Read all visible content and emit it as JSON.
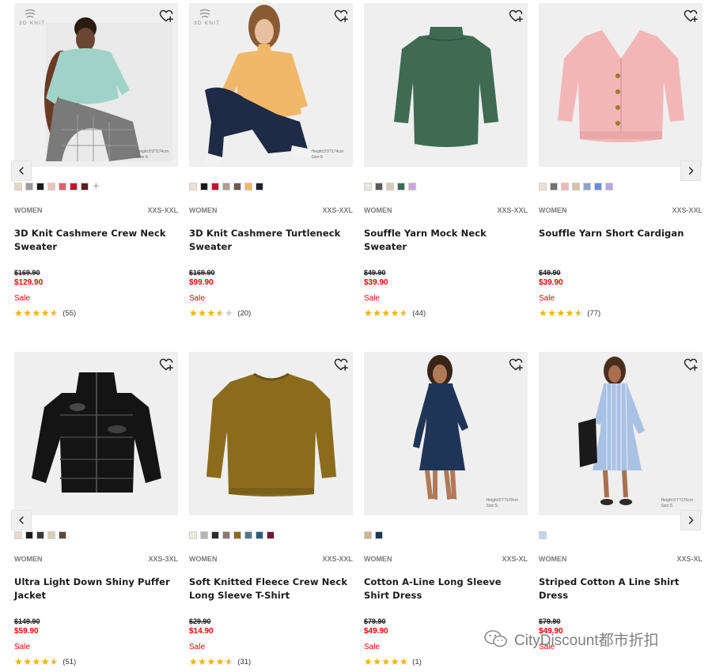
{
  "colors": {
    "sale_red": "#ff0000",
    "star": "#f4b400",
    "image_bg": "#efefef"
  },
  "products": [
    {
      "gender": "WOMEN",
      "sizes": "XXS-XXL",
      "name": "3D Knit Cashmere Crew Neck Sweater",
      "original_price": "$169.90",
      "sale_price": "$129.90",
      "flag": "Sale",
      "rating": 4.5,
      "reviews": "(55)",
      "badge": "3D KNIT",
      "model_info": [
        "Height:5'9\"/174cm",
        "Size:S"
      ],
      "image_desc": "model-mint-sweater",
      "garment_color": "#9fd3c7",
      "swatches": [
        "#e9d7c3",
        "#9a9a9a",
        "#1a1a1a",
        "#e6c3bd",
        "#e06070",
        "#c8102e",
        "#5a1e1e"
      ],
      "more_colors": "+"
    },
    {
      "gender": "WOMEN",
      "sizes": "XXS-XXL",
      "name": "3D Knit Cashmere Turtleneck Sweater",
      "original_price": "$169.90",
      "sale_price": "$99.90",
      "flag": "Sale",
      "rating": 3.5,
      "reviews": "(20)",
      "badge": "3D KNIT",
      "model_info": [
        "Height:5'9\"/174cm",
        "Size:S"
      ],
      "image_desc": "model-yellow-turtleneck",
      "garment_color": "#f1b86a",
      "swatches": [
        "#ece1d1",
        "#1a1a1a",
        "#c8102e",
        "#b39a8e",
        "#6e5a4e",
        "#f1b86a",
        "#1e2230"
      ]
    },
    {
      "gender": "WOMEN",
      "sizes": "XXS-XXL",
      "name": "Souffle Yarn Mock Neck Sweater",
      "original_price": "$49.90",
      "sale_price": "$39.90",
      "flag": "Sale",
      "rating": 4.5,
      "reviews": "(44)",
      "image_desc": "green-mock-neck-sweater",
      "garment_color": "#3e6b52",
      "swatches": [
        "#ece8df",
        "#5a5a5a",
        "#d8c9b3",
        "#3e6b52",
        "#c8a8dc"
      ]
    },
    {
      "gender": "WOMEN",
      "sizes": "XXS-XXL",
      "name": "Souffle Yarn Short Cardigan",
      "original_price": "$49.90",
      "sale_price": "$39.90",
      "flag": "Sale",
      "rating": 4.5,
      "reviews": "(77)",
      "image_desc": "pink-cardigan",
      "garment_color": "#f3b6b6",
      "swatches": [
        "#ece0d0",
        "#707070",
        "#f3b6b6",
        "#d9c2a3",
        "#8fa6c8",
        "#6a8fd8",
        "#b8a5e2"
      ]
    },
    {
      "gender": "WOMEN",
      "sizes": "XXS-3XL",
      "name": "Ultra Light Down Shiny Puffer Jacket",
      "original_price": "$149.90",
      "sale_price": "$59.90",
      "flag": "Sale",
      "rating": 4.5,
      "reviews": "(51)",
      "image_desc": "black-puffer-jacket",
      "garment_color": "#141414",
      "swatches": [
        "#e6dcd3",
        "#1a1a1a",
        "#3a3a3a",
        "#d8ccb8",
        "#5a4a40"
      ]
    },
    {
      "gender": "WOMEN",
      "sizes": "XXS-XXL",
      "name": "Soft Knitted Fleece Crew Neck Long Sleeve T-Shirt",
      "original_price": "$29.90",
      "sale_price": "$14.90",
      "flag": "Sale",
      "rating": 4.5,
      "reviews": "(31)",
      "image_desc": "olive-crew-neck-tshirt",
      "garment_color": "#8a6c1c",
      "swatches": [
        "#ece8df",
        "#b4b4b4",
        "#2a2a2a",
        "#8c7a6e",
        "#8a6c1c",
        "#4d7a8c",
        "#2e5b78",
        "#6a1a3a"
      ]
    },
    {
      "gender": "WOMEN",
      "sizes": "XXS-XL",
      "name": "Cotton A-Line Long Sleeve Shirt Dress",
      "original_price": "$79.90",
      "sale_price": "$49.90",
      "flag": "Sale",
      "rating": 5,
      "reviews": "(1)",
      "model_info": [
        "Height:5'7\"/170cm",
        "Size:S"
      ],
      "image_desc": "model-navy-shirt-dress",
      "garment_color": "#1f3557",
      "swatches": [
        "#cdb594",
        "#1f3557"
      ]
    },
    {
      "gender": "WOMEN",
      "sizes": "XXS-XL",
      "name": "Striped Cotton A Line Shirt Dress",
      "original_price": "$79.90",
      "sale_price": "$49.90",
      "flag": "Sale",
      "rating": null,
      "reviews": "",
      "model_info": [
        "Height:5'7\"/170cm",
        "Size:S"
      ],
      "image_desc": "model-striped-shirt-dress",
      "garment_color": "#a9c2e4",
      "swatches": [
        "#c6d4f0"
      ]
    }
  ],
  "watermark": "CityDiscount都市折扣",
  "icons": {
    "wishlist": "heart-plus-icon",
    "prev": "chevron-left-icon",
    "next": "chevron-right-icon",
    "star": "star-icon",
    "watermark": "wechat-icon"
  }
}
